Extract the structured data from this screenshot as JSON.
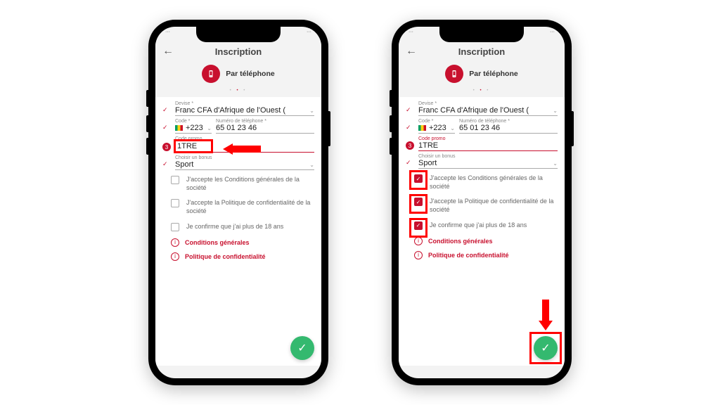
{
  "header": {
    "title": "Inscription",
    "method_label": "Par téléphone"
  },
  "fields": {
    "currency_label": "Devise *",
    "currency_value": "Franc CFA d'Afrique de l'Ouest (",
    "code_label": "Code *",
    "code_value": "+223",
    "phone_label": "Numéro de téléphone *",
    "phone_value": "65 01 23 46",
    "promo_label": "Code promo",
    "promo_value": "1TRE",
    "bonus_label": "Choisir un bonus",
    "bonus_value": "Sport",
    "step_badge": "3"
  },
  "checks": {
    "c1": "J'accepte les Conditions générales de la société",
    "c2": "J'accepte la Politique de confidentialité de la société",
    "c3": "Je confirme que j'ai plus de 18 ans"
  },
  "links": {
    "l1": "Conditions générales",
    "l2": "Politique de confidentialité"
  }
}
